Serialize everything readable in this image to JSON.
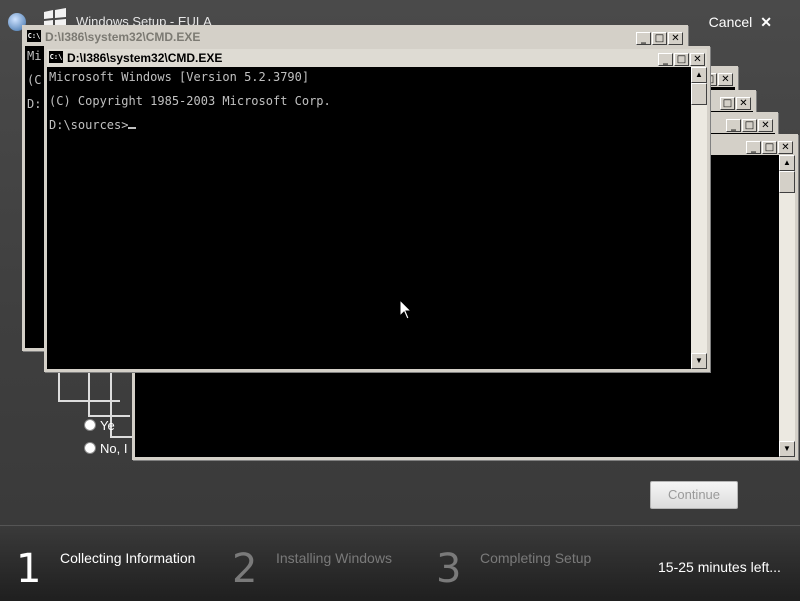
{
  "setup": {
    "title": "Windows Setup - EULA",
    "cancel_label": "Cancel",
    "options": [
      "Ye",
      "No, I"
    ],
    "continue_label": "Continue"
  },
  "background_window": {
    "title": "D:\\I386\\system32\\CMD.EXE",
    "lines": [
      "Mi",
      "(C",
      "D:"
    ]
  },
  "main_window": {
    "title": "D:\\I386\\system32\\CMD.EXE",
    "icon_text": "C:\\",
    "lines": [
      "Microsoft Windows [Version 5.2.3790]",
      "(C) Copyright 1985-2003 Microsoft Corp.",
      "D:\\sources>"
    ]
  },
  "progress": {
    "steps": [
      {
        "number": "1",
        "label": "Collecting Information",
        "active": true
      },
      {
        "number": "2",
        "label": "Installing Windows",
        "active": false
      },
      {
        "number": "3",
        "label": "Completing Setup",
        "active": false
      }
    ],
    "time_left": "15-25 minutes left..."
  },
  "icons": {
    "minimize": "minimize-icon",
    "maximize": "maximize-icon",
    "close": "close-icon"
  }
}
